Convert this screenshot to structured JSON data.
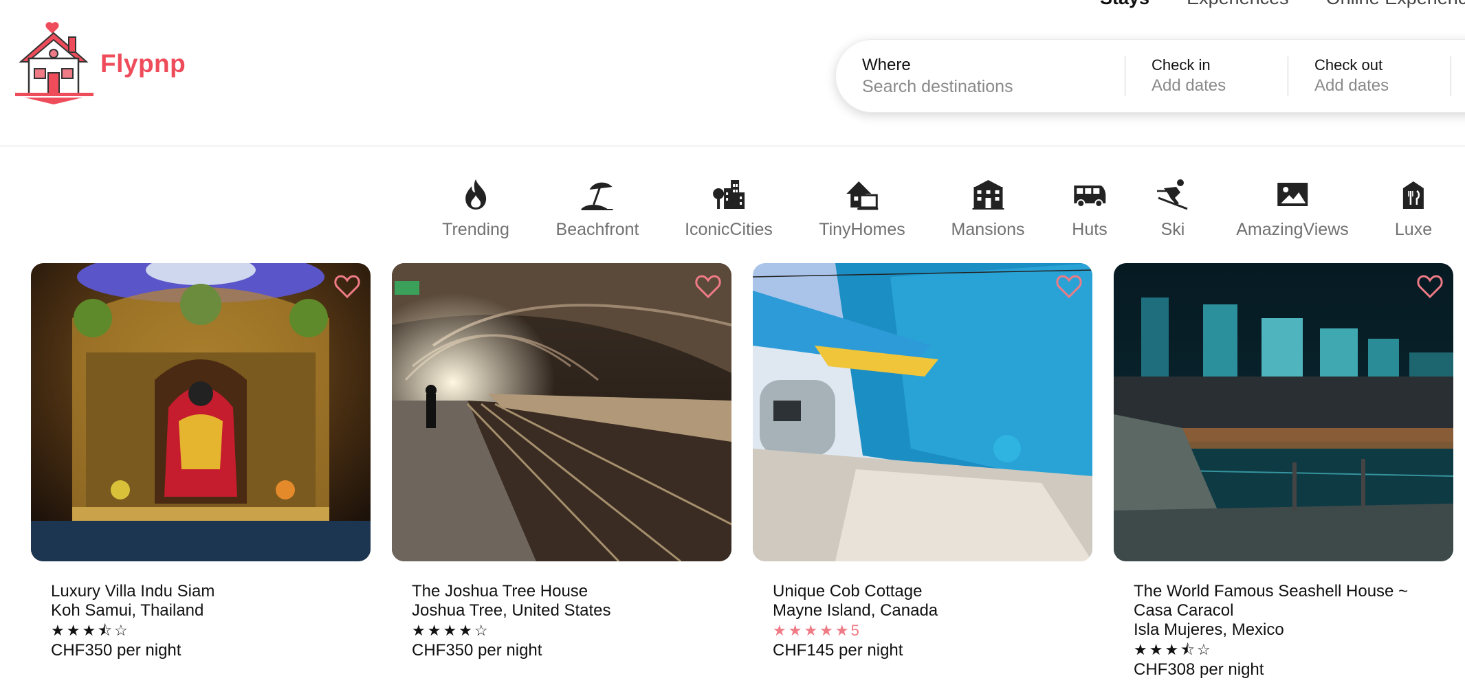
{
  "brand": {
    "name": "Flypnp"
  },
  "topnav": {
    "stays": "Stays",
    "experiences": "Experiences",
    "online": "Online Experiences"
  },
  "search": {
    "where_label": "Where",
    "where_placeholder": "Search destinations",
    "checkin_label": "Check in",
    "checkin_placeholder": "Add dates",
    "checkout_label": "Check out",
    "checkout_placeholder": "Add dates"
  },
  "categories": [
    {
      "label": "Trending",
      "icon": "flame-icon"
    },
    {
      "label": "Beachfront",
      "icon": "beach-umbrella-icon"
    },
    {
      "label": "IconicCities",
      "icon": "city-icon"
    },
    {
      "label": "TinyHomes",
      "icon": "tiny-home-icon"
    },
    {
      "label": "Mansions",
      "icon": "mansion-icon"
    },
    {
      "label": "Huts",
      "icon": "van-icon"
    },
    {
      "label": "Ski",
      "icon": "skier-icon"
    },
    {
      "label": "AmazingViews",
      "icon": "picture-icon"
    },
    {
      "label": "Luxe",
      "icon": "luxe-icon"
    }
  ],
  "listings": [
    {
      "title": "Luxury Villa Indu Siam",
      "title2": "",
      "location": "Koh Samui, Thailand",
      "stars": "★★★⯪☆",
      "rating_num": "",
      "price": "CHF350 per night"
    },
    {
      "title": "The Joshua Tree House",
      "title2": "",
      "location": "Joshua Tree, United States",
      "stars": "★★★★☆",
      "rating_num": "",
      "price": "CHF350 per night"
    },
    {
      "title": "Unique Cob Cottage",
      "title2": "",
      "location": "Mayne Island, Canada",
      "stars": "★★★★★",
      "rating_num": "5",
      "price": "CHF145 per night"
    },
    {
      "title": "The World Famous Seashell House ~",
      "title2": "Casa Caracol",
      "location": "Isla Mujeres, Mexico",
      "stars": "★★★⯪☆",
      "rating_num": "",
      "price": "CHF308 per night"
    }
  ],
  "colors": {
    "brand": "#ef4c5b",
    "heart": "#ef7b86",
    "muted": "#717171"
  }
}
